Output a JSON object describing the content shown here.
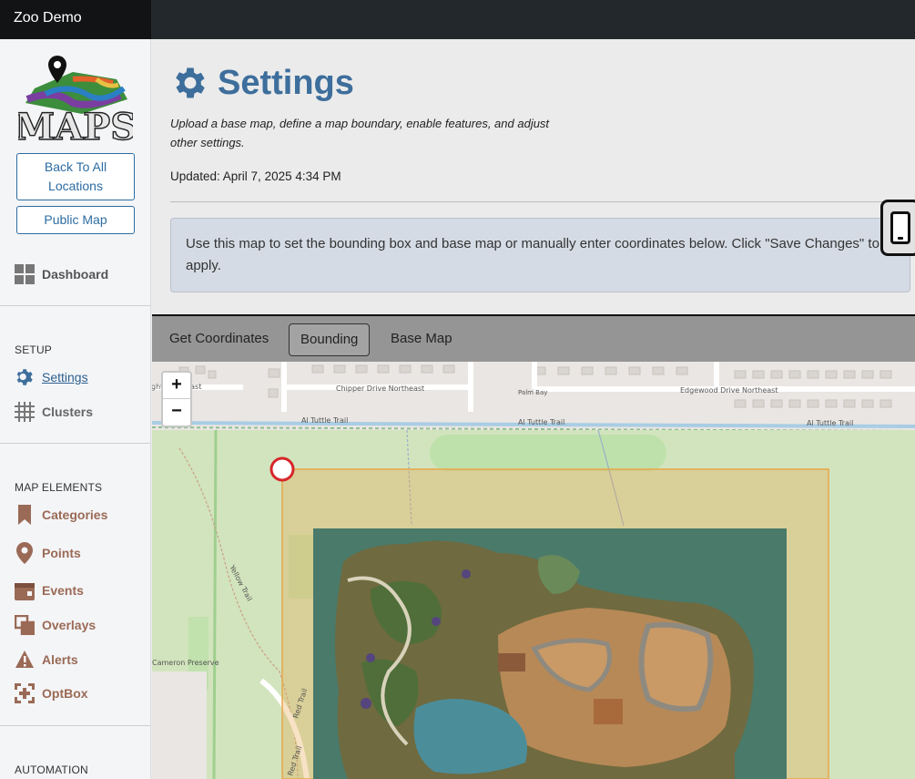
{
  "app": {
    "title": "Zoo Demo"
  },
  "sidebar": {
    "logo_text": "MAPS",
    "back_label": "Back To All Locations",
    "public_label": "Public Map",
    "dashboard": "Dashboard",
    "setup_heading": "SETUP",
    "settings": "Settings",
    "clusters": "Clusters",
    "elements_heading": "MAP ELEMENTS",
    "categories": "Categories",
    "points": "Points",
    "events": "Events",
    "overlays": "Overlays",
    "alerts": "Alerts",
    "optbox": "OptBox",
    "automation_heading": "AUTOMATION"
  },
  "page": {
    "title": "Settings",
    "description": "Upload a base map, define a map boundary, enable features, and adjust other settings.",
    "updated": "Updated: April 7, 2025 4:34 PM",
    "info": "Use this map to set the bounding box and base map or manually enter coordinates below. Click \"Save Changes\" to apply."
  },
  "tabs": {
    "get_coordinates": "Get Coordinates",
    "bounding": "Bounding",
    "base_map": "Base Map"
  },
  "map": {
    "zoom_in": "+",
    "zoom_out": "−",
    "streets": {
      "s1": "ght Northeast",
      "s2": "Chipper Drive Northeast",
      "s3": "Edgewood Drive Northeast",
      "t1": "Al Tuttle Trail",
      "t2": "Al Tuttle Trail",
      "t3": "Al Tuttle Trail",
      "palm": "Palm Bay",
      "yellow": "Yellow Trail",
      "red1": "Red Trail",
      "red2": "Red Trail",
      "cameron": "Cameron Preserve"
    }
  },
  "colors": {
    "accent": "#3d6e9c",
    "sidebar_link": "#2d6ca2",
    "element_label": "#9a6a56",
    "boundary": "#e8a64a"
  }
}
